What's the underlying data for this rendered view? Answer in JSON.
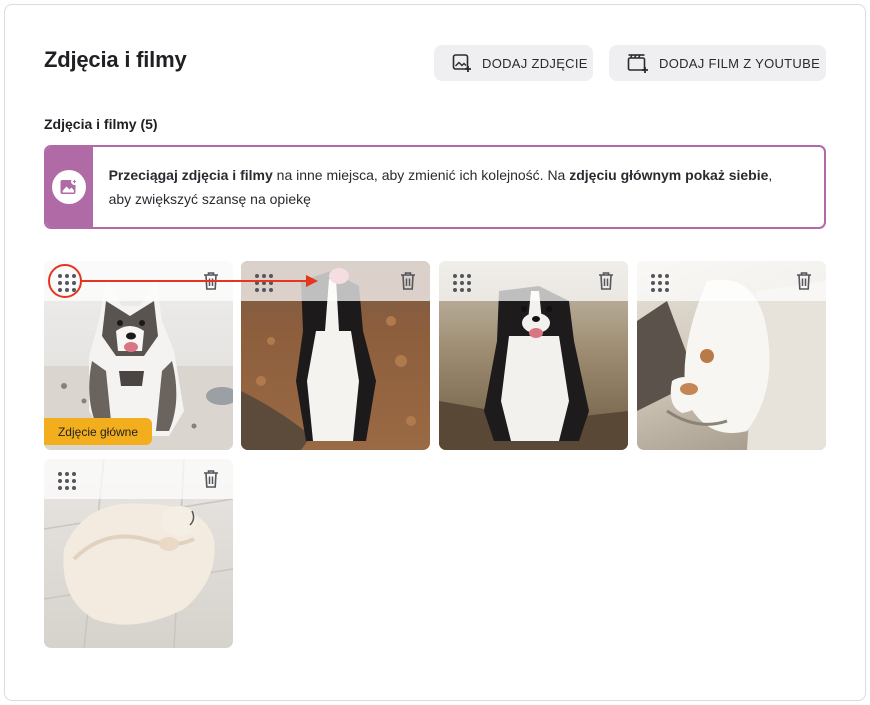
{
  "header": {
    "title": "Zdjęcia i filmy",
    "add_photo_label": "DODAJ ZDJĘCIE",
    "add_film_label": "DODAJ FILM Z YOUTUBE"
  },
  "section": {
    "label": "Zdjęcia i filmy (5)"
  },
  "info": {
    "part1_bold": "Przeciągaj zdjęcia i filmy",
    "part2": " na inne miejsca, aby zmienić ich kolejność. Na ",
    "part3_bold": "zdjęciu głównym pokaż siebie",
    "part4": ", aby zwiększyć szansę na opiekę"
  },
  "photos": [
    {
      "subject": "husky-dog",
      "is_main": true,
      "badge": "Zdjęcie główne"
    },
    {
      "subject": "border-collie-dog",
      "is_main": false
    },
    {
      "subject": "border-collie-dog",
      "is_main": false
    },
    {
      "subject": "calico-cat",
      "is_main": false
    },
    {
      "subject": "white-fluffy-cat",
      "is_main": false
    }
  ],
  "colors": {
    "accent": "#b06aa6",
    "badge": "#f2ae1c",
    "annotation": "#e5351f",
    "button_bg": "#efeff1"
  },
  "icons": {
    "add_photo": "image-plus-icon",
    "add_film": "film-plus-icon",
    "info": "image-sparkle-icon",
    "drag": "drag-grip-icon",
    "delete": "trash-icon"
  }
}
